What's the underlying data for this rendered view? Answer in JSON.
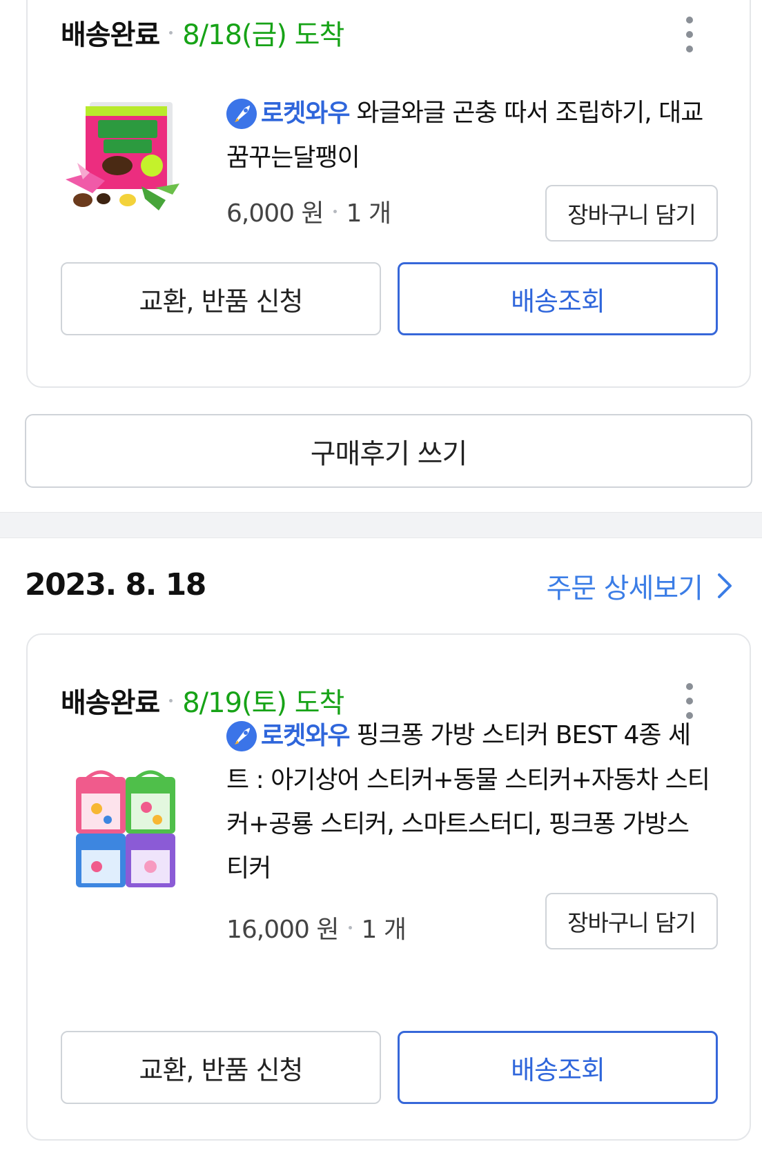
{
  "orders": [
    {
      "status": "배송완료",
      "arrival": "8/18(금) 도착",
      "rocket_label": "로켓와우",
      "product_name": "와글와글 곤충 따서 조립하기, 대교꿈꾸는달팽이",
      "price": "6,000 원",
      "quantity": "1 개",
      "cart_button": "장바구니 담기",
      "return_button": "교환, 반품 신청",
      "track_button": "배송조회"
    },
    {
      "status": "배송완료",
      "arrival": "8/19(토) 도착",
      "rocket_label": "로켓와우",
      "product_name": "핑크퐁 가방 스티커 BEST 4종 세트 : 아기상어 스티커+동물 스티커+자동차 스티커+공룡 스티커, 스마트스터디, 핑크퐁 가방스티커",
      "price": "16,000 원",
      "quantity": "1 개",
      "cart_button": "장바구니 담기",
      "return_button": "교환, 반품 신청",
      "track_button": "배송조회"
    }
  ],
  "review_button": "구매후기 쓰기",
  "order_group": {
    "date": "2023. 8. 18",
    "detail_link": "주문 상세보기"
  },
  "colors": {
    "arrival_green": "#17a317",
    "accent_blue": "#2f66db",
    "link_blue": "#3b7de6"
  },
  "icons": [
    "more-vertical-icon",
    "rocket-icon",
    "chevron-right-icon"
  ]
}
